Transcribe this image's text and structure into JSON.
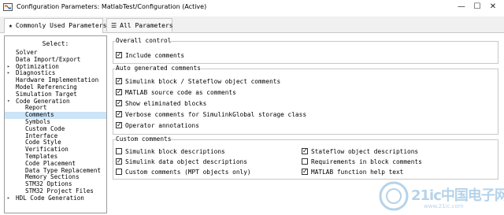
{
  "window": {
    "title": "Configuration Parameters: MatlabTest/Configuration (Active)",
    "controls": {
      "minimize": "—",
      "maximize": "☐",
      "close": "✕"
    }
  },
  "tabs": [
    {
      "label": "Commonly Used Parameters",
      "icon": "star-icon",
      "glyph": "★"
    },
    {
      "label": "All Parameters",
      "icon": "list-icon",
      "glyph": "☰"
    }
  ],
  "sidebar": {
    "header": "Select:",
    "items": [
      {
        "label": "Solver",
        "level": 0,
        "arrow": ""
      },
      {
        "label": "Data Import/Export",
        "level": 0,
        "arrow": ""
      },
      {
        "label": "Optimization",
        "level": 0,
        "arrow": "▸"
      },
      {
        "label": "Diagnostics",
        "level": 0,
        "arrow": "▸"
      },
      {
        "label": "Hardware Implementation",
        "level": 0,
        "arrow": ""
      },
      {
        "label": "Model Referencing",
        "level": 0,
        "arrow": ""
      },
      {
        "label": "Simulation Target",
        "level": 0,
        "arrow": ""
      },
      {
        "label": "Code Generation",
        "level": 0,
        "arrow": "▾"
      },
      {
        "label": "Report",
        "level": 1,
        "arrow": ""
      },
      {
        "label": "Comments",
        "level": 1,
        "arrow": "",
        "selected": true
      },
      {
        "label": "Symbols",
        "level": 1,
        "arrow": ""
      },
      {
        "label": "Custom Code",
        "level": 1,
        "arrow": ""
      },
      {
        "label": "Interface",
        "level": 1,
        "arrow": ""
      },
      {
        "label": "Code Style",
        "level": 1,
        "arrow": ""
      },
      {
        "label": "Verification",
        "level": 1,
        "arrow": ""
      },
      {
        "label": "Templates",
        "level": 1,
        "arrow": ""
      },
      {
        "label": "Code Placement",
        "level": 1,
        "arrow": ""
      },
      {
        "label": "Data Type Replacement",
        "level": 1,
        "arrow": ""
      },
      {
        "label": "Memory Sections",
        "level": 1,
        "arrow": ""
      },
      {
        "label": "STM32 Options",
        "level": 1,
        "arrow": ""
      },
      {
        "label": "STM32 Project Files",
        "level": 1,
        "arrow": ""
      },
      {
        "label": "HDL Code Generation",
        "level": 0,
        "arrow": "▸"
      }
    ]
  },
  "overall": {
    "title": "Overall control",
    "include_comments": {
      "label": "Include comments",
      "checked": true
    }
  },
  "auto": {
    "title": "Auto generated comments",
    "items": [
      {
        "label": "Simulink block / Stateflow object comments",
        "checked": true
      },
      {
        "label": "MATLAB source code as comments",
        "checked": true
      },
      {
        "label": "Show eliminated blocks",
        "checked": true
      },
      {
        "label": "Verbose comments for SimulinkGlobal storage class",
        "checked": true
      },
      {
        "label": "Operator annotations",
        "checked": true
      }
    ]
  },
  "custom": {
    "title": "Custom comments",
    "left": [
      {
        "label": "Simulink block descriptions",
        "checked": false
      },
      {
        "label": "Simulink data object descriptions",
        "checked": true
      },
      {
        "label": "Custom comments (MPT objects only)",
        "checked": false
      }
    ],
    "right": [
      {
        "label": "Stateflow object descriptions",
        "checked": true
      },
      {
        "label": "Requirements in block comments",
        "checked": false
      },
      {
        "label": "MATLAB function help text",
        "checked": true
      }
    ]
  },
  "watermark": {
    "text": "21ic中国电子网",
    "sub": "www.21ic.com"
  },
  "colors": {
    "selection": "#cce4f7",
    "border": "#c8c8c8",
    "watermark": "#7ab0d8"
  }
}
